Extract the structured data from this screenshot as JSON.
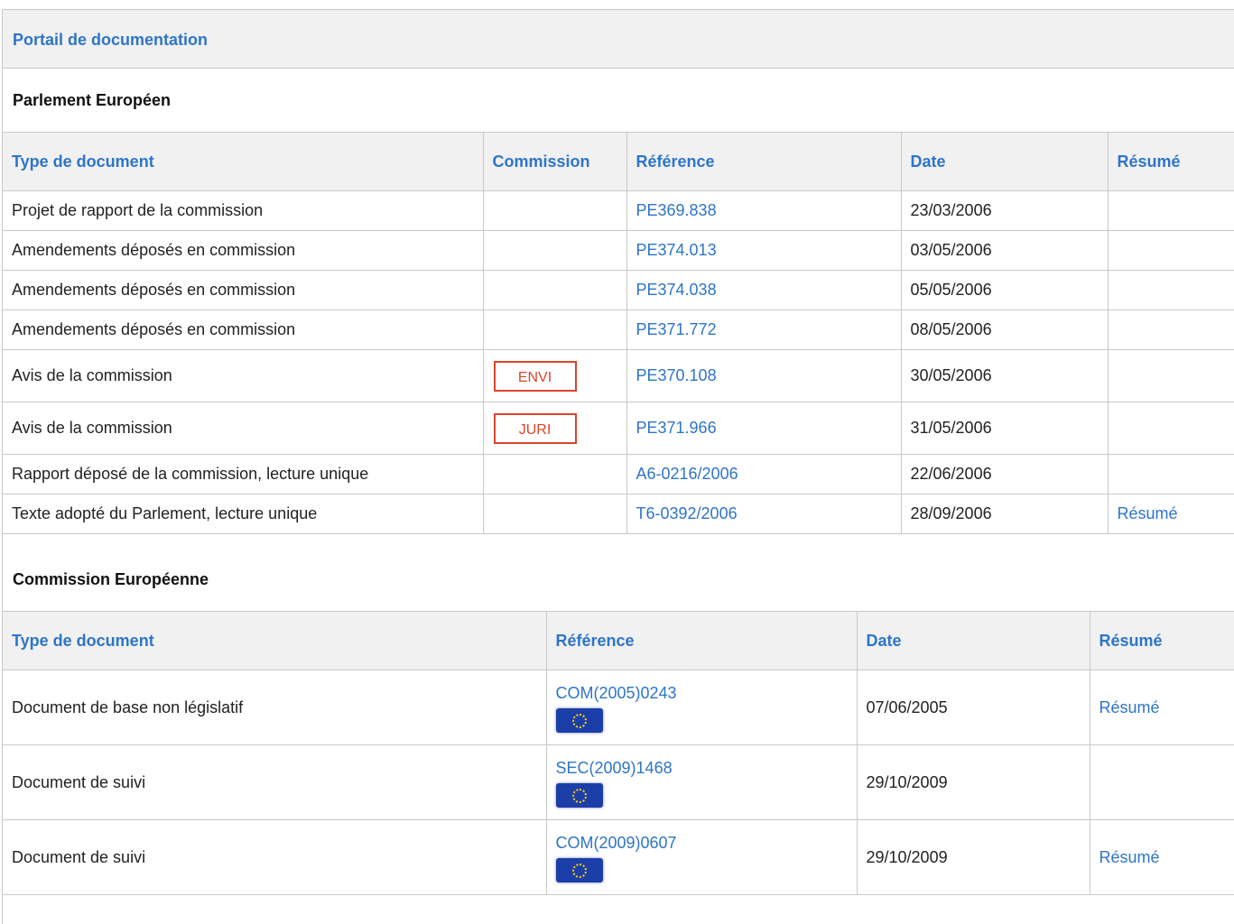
{
  "portal": {
    "title": "Portail de documentation"
  },
  "parlement": {
    "title": "Parlement Européen",
    "headers": [
      "Type de document",
      "Commission",
      "Référence",
      "Date",
      "Résumé"
    ],
    "rows": [
      {
        "type": "Projet de rapport de la commission",
        "commission": "",
        "reference": "PE369.838",
        "date": "23/03/2006",
        "resume": ""
      },
      {
        "type": "Amendements déposés en commission",
        "commission": "",
        "reference": "PE374.013",
        "date": "03/05/2006",
        "resume": ""
      },
      {
        "type": "Amendements déposés en commission",
        "commission": "",
        "reference": "PE374.038",
        "date": "05/05/2006",
        "resume": ""
      },
      {
        "type": "Amendements déposés en commission",
        "commission": "",
        "reference": "PE371.772",
        "date": "08/05/2006",
        "resume": ""
      },
      {
        "type": "Avis de la commission",
        "commission": "ENVI",
        "reference": "PE370.108",
        "date": "30/05/2006",
        "resume": ""
      },
      {
        "type": "Avis de la commission",
        "commission": "JURI",
        "reference": "PE371.966",
        "date": "31/05/2006",
        "resume": ""
      },
      {
        "type": "Rapport déposé de la commission, lecture unique",
        "commission": "",
        "reference": "A6-0216/2006",
        "date": "22/06/2006",
        "resume": ""
      },
      {
        "type": "Texte adopté du Parlement, lecture unique",
        "commission": "",
        "reference": "T6-0392/2006",
        "date": "28/09/2006",
        "resume": "Résumé"
      }
    ]
  },
  "commission": {
    "title": "Commission Européenne",
    "headers": [
      "Type de document",
      "Référence",
      "Date",
      "Résumé"
    ],
    "rows": [
      {
        "type": "Document de base non législatif",
        "reference": "COM(2005)0243",
        "flag_icon": "eu-flag-icon",
        "date": "07/06/2005",
        "resume": "Résumé"
      },
      {
        "type": "Document de suivi",
        "reference": "SEC(2009)1468",
        "flag_icon": "eu-flag-icon",
        "date": "29/10/2009",
        "resume": ""
      },
      {
        "type": "Document de suivi",
        "reference": "COM(2009)0607",
        "flag_icon": "eu-flag-icon",
        "date": "29/10/2009",
        "resume": "Résumé"
      }
    ]
  },
  "colors": {
    "link": "#2e75c7",
    "badge": "#d8452b",
    "header_bg": "#f1f1f1",
    "border": "#c9c9c9"
  }
}
